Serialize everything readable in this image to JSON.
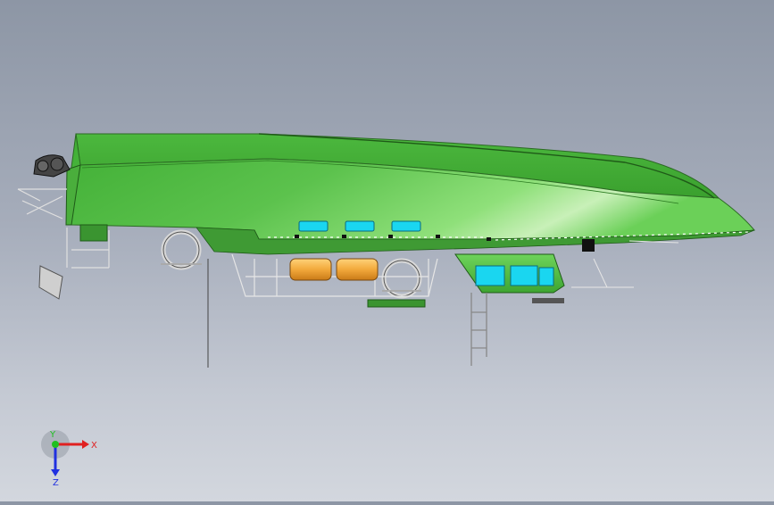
{
  "viewport": {
    "background_top": "#8d96a5",
    "background_bottom": "#d3d7de",
    "model": {
      "hull_color": "#5cc24d",
      "hull_dark": "#2c8a24",
      "hull_light": "#c8f0b8",
      "window_color": "#1ad6f0",
      "liferaft_color": "#f2a93b"
    }
  },
  "triad": {
    "x_label": "X",
    "y_label": "Y",
    "z_label": "Z",
    "x_color": "#e02020",
    "y_color": "#20c020",
    "z_color": "#2030e0"
  }
}
